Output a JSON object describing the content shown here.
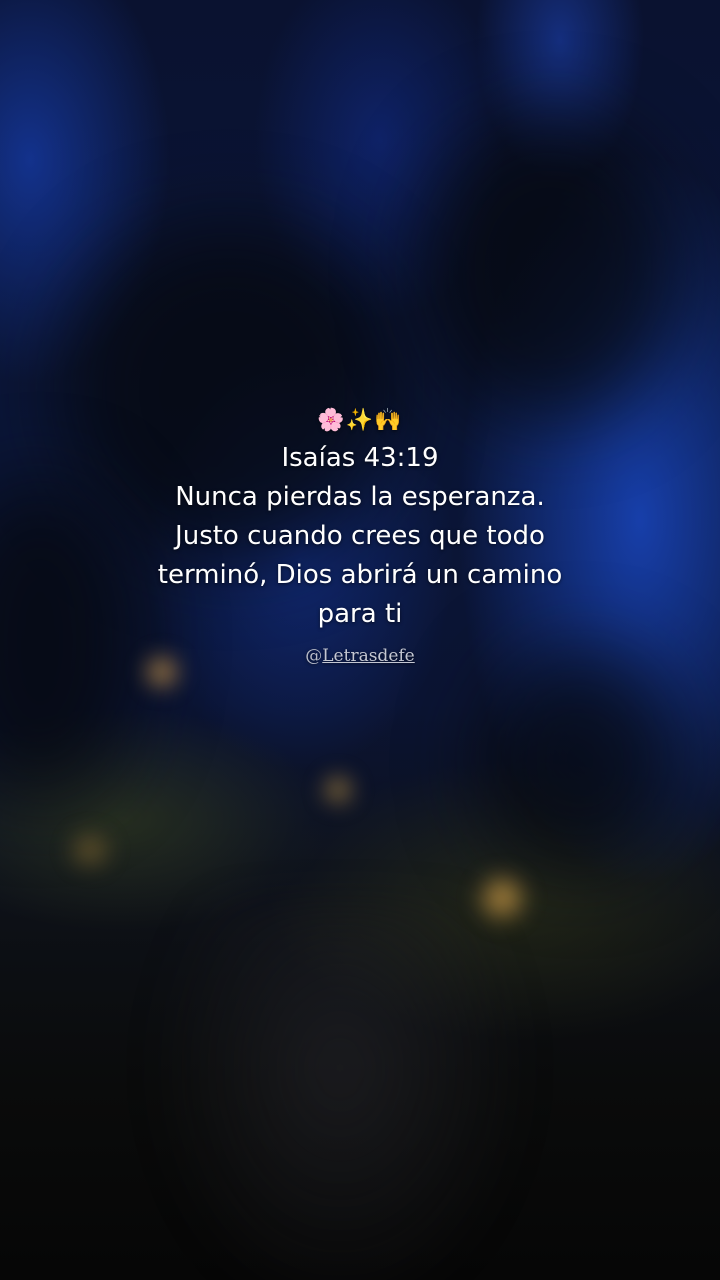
{
  "emoji": {
    "flower": "🌸",
    "sparkles": "✨",
    "praise_hands": "🙌"
  },
  "quote": {
    "reference": "Isaías 43:19",
    "lines": [
      "Nunca pierdas la esperanza.",
      "Justo cuando crees que todo",
      "terminó, Dios abrirá un camino",
      "para ti"
    ]
  },
  "handle": {
    "at": "@",
    "name": "Letrasdefe"
  }
}
